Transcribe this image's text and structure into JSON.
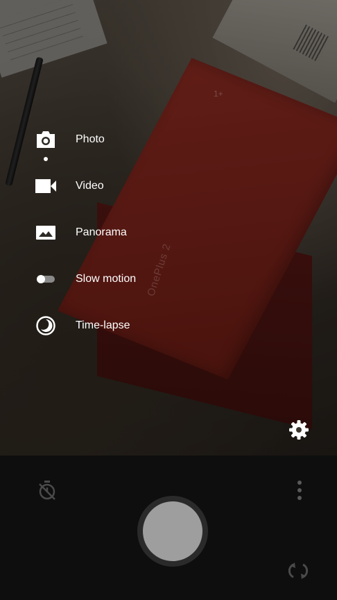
{
  "camera": {
    "modes": [
      {
        "label": "Photo",
        "icon": "camera-icon",
        "selected": true
      },
      {
        "label": "Video",
        "icon": "video-camera-icon",
        "selected": false
      },
      {
        "label": "Panorama",
        "icon": "panorama-icon",
        "selected": false
      },
      {
        "label": "Slow motion",
        "icon": "slow-motion-icon",
        "selected": false
      },
      {
        "label": "Time-lapse",
        "icon": "time-lapse-icon",
        "selected": false
      }
    ],
    "scene": {
      "box_brand": "OnePlus 2"
    },
    "controls": {
      "settings_icon": "gear-icon",
      "timer_icon": "timer-off-icon",
      "more_icon": "more-vertical-icon",
      "shutter_icon": "shutter-button",
      "flip_icon": "switch-camera-icon"
    },
    "colors": {
      "label": "#ffffff",
      "control_bar": "#0e0e0e",
      "shutter_inner": "#9e9e9e",
      "dimmed_icon": "#4a4a4a"
    }
  }
}
